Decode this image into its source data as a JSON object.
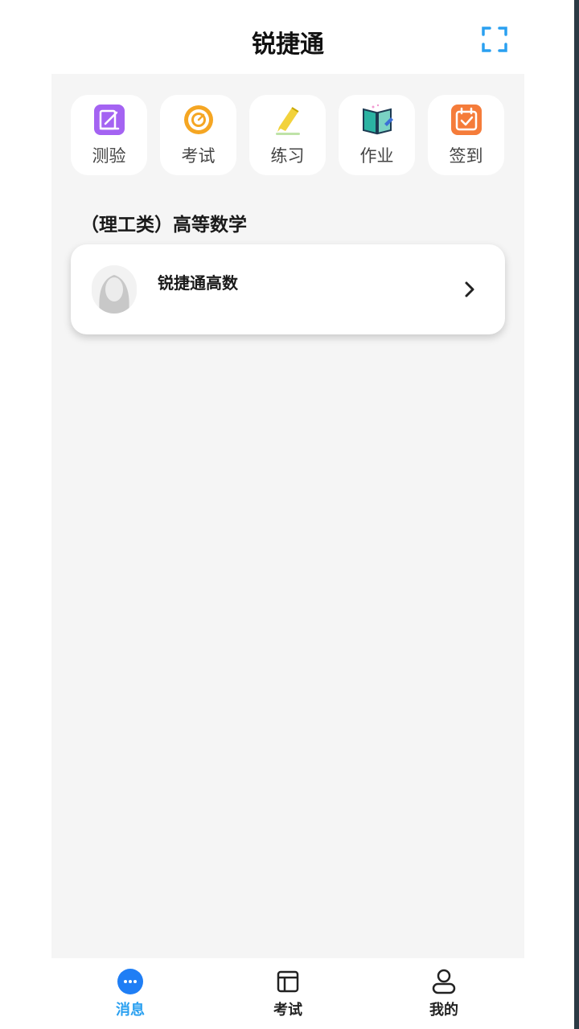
{
  "header": {
    "title": "锐捷通"
  },
  "quick_actions": [
    {
      "label": "测验",
      "icon": "quiz-icon",
      "color": "#a463f2"
    },
    {
      "label": "考试",
      "icon": "target-icon",
      "color": "#f5a623"
    },
    {
      "label": "练习",
      "icon": "pencil-icon",
      "color": "#f2d23c"
    },
    {
      "label": "作业",
      "icon": "book-icon",
      "color": "#2bb3a3"
    },
    {
      "label": "签到",
      "icon": "calendar-check-icon",
      "color": "#f57c3a"
    }
  ],
  "section": {
    "title": "（理工类）高等数学"
  },
  "course_card": {
    "name": "锐捷通高数"
  },
  "tabbar": [
    {
      "label": "消息",
      "icon": "message-icon",
      "active": true
    },
    {
      "label": "考试",
      "icon": "exam-icon",
      "active": false
    },
    {
      "label": "我的",
      "icon": "user-icon",
      "active": false
    }
  ],
  "colors": {
    "accent": "#2aa0f0",
    "tab_active_icon": "#1f7ef5",
    "background": "#f5f5f5"
  }
}
